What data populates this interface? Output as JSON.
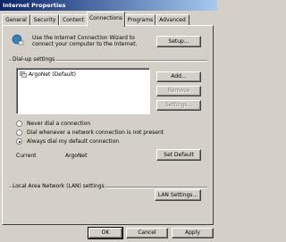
{
  "window": {
    "title": "Internet Properties"
  },
  "tabs": [
    "General",
    "Security",
    "Content",
    "Connections",
    "Programs",
    "Advanced"
  ],
  "wizard": {
    "text_line1": "Use the Internet Connection Wizard to",
    "text_line2": "connect your computer to the Internet.",
    "setup_label": "Setup..."
  },
  "dialup": {
    "group_label": "Dial-up settings",
    "entries": [
      "ArgoNet (Default)"
    ],
    "add_label": "Add...",
    "remove_label": "Remove",
    "settings_label": "Settings..."
  },
  "dial_options": [
    {
      "label": "Never dial a connection",
      "checked": false
    },
    {
      "label": "Dial whenever a network connection is not present",
      "checked": false
    },
    {
      "label": "Always dial my default connection",
      "checked": true
    }
  ],
  "current": {
    "label": "Current",
    "value": "ArgoNet",
    "set_default_label": "Set Default"
  },
  "lan": {
    "group_label": "Local Area Network (LAN) settings",
    "lan_settings_label": "LAN Settings..."
  },
  "footer": {
    "ok_label": "OK",
    "cancel_label": "Cancel",
    "apply_label": "Apply"
  }
}
